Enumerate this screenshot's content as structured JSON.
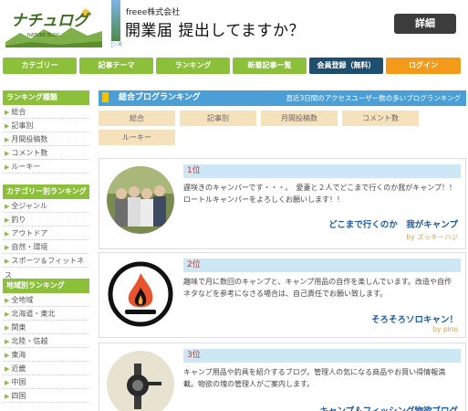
{
  "logo": {
    "text": "ナチュログ",
    "sub": "NATURE BLOG"
  },
  "ad": {
    "company": "freee株式会社",
    "headline": "開業届 提出してますか？",
    "detail_label": "詳細"
  },
  "nav": {
    "tabs": [
      {
        "label": "カテゴリー",
        "style": "green"
      },
      {
        "label": "記事テーマ",
        "style": "green"
      },
      {
        "label": "ランキング",
        "style": "green"
      },
      {
        "label": "新着記事一覧",
        "style": "green"
      },
      {
        "label": "会員登録（無料）",
        "style": "navy"
      },
      {
        "label": "ログイン",
        "style": "orange"
      }
    ]
  },
  "sidebar": {
    "sections": [
      {
        "heading": "ランキング種類",
        "items": [
          "総合",
          "記事別",
          "月間投稿数",
          "コメント数",
          "ルーキー"
        ]
      },
      {
        "heading": "カテゴリー別ランキング",
        "items": [
          "全ジャンル",
          "釣り",
          "アウトドア",
          "自然・環境",
          "スポーツ＆フィットネス"
        ]
      },
      {
        "heading": "地域別ランキング",
        "items": [
          "全地域",
          "北海道・東北",
          "関東",
          "北陸・信越",
          "東海",
          "近畿",
          "中国",
          "四国"
        ]
      }
    ]
  },
  "main": {
    "header_title": "総合ブログランキング",
    "header_sub": "直近3日間のアクセスユーザー数の多いブログランキング",
    "categories": [
      "総合",
      "記事別",
      "月間投稿数",
      "コメント数",
      "ルーキー"
    ],
    "entries": [
      {
        "rank": "1位",
        "desc": "遅咲きのキャンパーです・・・。　愛妻と２人でどこまで行くのか我がキャンプ！！　ロートルキャンパーをよろしくお願いします！！",
        "blog": "どこまで行くのか　我がキャンプ",
        "by_prefix": "by",
        "author": "ズッキーハジ"
      },
      {
        "rank": "2位",
        "desc": "趣味で月に数回のキャンプと、キャンプ用品の自作を楽しんでいます。改造や自作ネタなどを参考になさる場合は、自己責任でお願い致します。",
        "blog": "そろそろソロキャン！",
        "by_prefix": "by",
        "author": "pino"
      },
      {
        "rank": "3位",
        "desc": "キャンプ用品や釣具を紹介するブログ。管理人の気になる商品やお買い得情報満載。物欲の塊の管理人がご案内します。",
        "blog": "キャンプ＆フィッシング物欲ブログ",
        "by_prefix": "",
        "author": ""
      }
    ]
  },
  "colors": {
    "green": "#8cbf3a",
    "navy": "#1f4f6e",
    "orange": "#f39a1a",
    "blue": "#4a9fd6"
  }
}
